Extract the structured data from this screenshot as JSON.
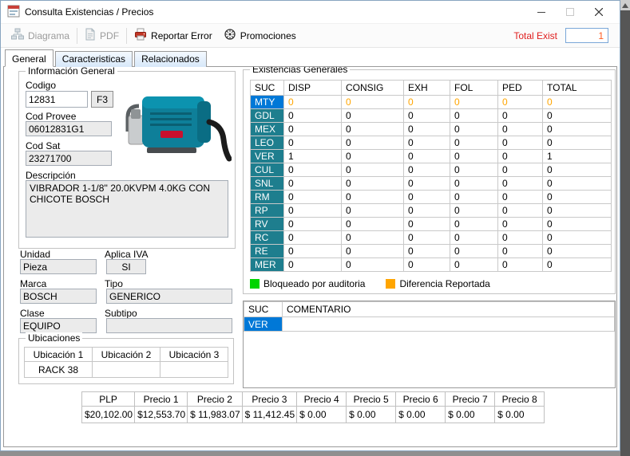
{
  "window": {
    "title": "Consulta Existencias / Precios"
  },
  "toolbar": {
    "items": [
      {
        "label": "Diagrama",
        "disabled": true
      },
      {
        "label": "PDF",
        "disabled": true
      },
      {
        "label": "Reportar Error",
        "disabled": false
      },
      {
        "label": "Promociones",
        "disabled": false
      }
    ],
    "total_exist_label": "Total Exist",
    "total_exist_value": "1"
  },
  "tabs": {
    "general": "General",
    "caracteristicas": "Caracteristicas",
    "relacionados": "Relacionados"
  },
  "info": {
    "group_title": "Información General",
    "codigo_label": "Codigo",
    "codigo_value": "12831",
    "f3_label": "F3",
    "cod_provee_label": "Cod Provee",
    "cod_provee_value": "06012831G1",
    "cod_sat_label": "Cod Sat",
    "cod_sat_value": "23271700",
    "descripcion_label": "Descripción",
    "descripcion_value": "VIBRADOR 1-1/8'' 20.0KVPM 4.0KG CON CHICOTE BOSCH"
  },
  "detalles": {
    "unidad_label": "Unidad",
    "unidad_value": "Pieza",
    "aplica_iva_label": "Aplica IVA",
    "aplica_iva_value": "SI",
    "marca_label": "Marca",
    "marca_value": "BOSCH",
    "tipo_label": "Tipo",
    "tipo_value": "GENERICO",
    "clase_label": "Clase",
    "clase_value": "EQUIPO",
    "subtipo_label": "Subtipo",
    "subtipo_value": ""
  },
  "ubicaciones": {
    "group_title": "Ubicaciones",
    "headers": [
      "Ubicación 1",
      "Ubicación 2",
      "Ubicación 3"
    ],
    "values": [
      "RACK 38",
      "",
      ""
    ]
  },
  "existencias": {
    "group_title": "Existencias Generales",
    "headers": [
      "SUC",
      "DISP",
      "CONSIG",
      "EXH",
      "FOL",
      "PED",
      "TOTAL"
    ],
    "rows": [
      {
        "suc": "MTY",
        "values": [
          "0",
          "0",
          "0",
          "0",
          "0",
          "0"
        ],
        "selected": true,
        "orange_values": true
      },
      {
        "suc": "GDL",
        "values": [
          "0",
          "0",
          "0",
          "0",
          "0",
          "0"
        ]
      },
      {
        "suc": "MEX",
        "values": [
          "0",
          "0",
          "0",
          "0",
          "0",
          "0"
        ]
      },
      {
        "suc": "LEO",
        "values": [
          "0",
          "0",
          "0",
          "0",
          "0",
          "0"
        ]
      },
      {
        "suc": "VER",
        "values": [
          "1",
          "0",
          "0",
          "0",
          "0",
          "1"
        ]
      },
      {
        "suc": "CUL",
        "values": [
          "0",
          "0",
          "0",
          "0",
          "0",
          "0"
        ]
      },
      {
        "suc": "SNL",
        "values": [
          "0",
          "0",
          "0",
          "0",
          "0",
          "0"
        ]
      },
      {
        "suc": "RM",
        "values": [
          "0",
          "0",
          "0",
          "0",
          "0",
          "0"
        ]
      },
      {
        "suc": "RP",
        "values": [
          "0",
          "0",
          "0",
          "0",
          "0",
          "0"
        ]
      },
      {
        "suc": "RV",
        "values": [
          "0",
          "0",
          "0",
          "0",
          "0",
          "0"
        ]
      },
      {
        "suc": "RC",
        "values": [
          "0",
          "0",
          "0",
          "0",
          "0",
          "0"
        ]
      },
      {
        "suc": "RE",
        "values": [
          "0",
          "0",
          "0",
          "0",
          "0",
          "0"
        ]
      },
      {
        "suc": "MER",
        "values": [
          "0",
          "0",
          "0",
          "0",
          "0",
          "0"
        ]
      }
    ],
    "legend": [
      {
        "color": "#00d400",
        "label": "Bloqueado por auditoria"
      },
      {
        "color": "#ffa500",
        "label": "Diferencia Reportada"
      }
    ]
  },
  "comentarios": {
    "headers": [
      "SUC",
      "COMENTARIO"
    ],
    "rows": [
      {
        "suc": "VER",
        "comentario": "",
        "selected": true
      }
    ]
  },
  "precios": {
    "headers": [
      "PLP",
      "Precio 1",
      "Precio 2",
      "Precio 3",
      "Precio 4",
      "Precio 5",
      "Precio 6",
      "Precio 7",
      "Precio 8"
    ],
    "values": [
      "$20,102.00",
      "$12,553.70",
      "$ 11,983.07",
      "$ 11,412.45",
      "$ 0.00",
      "$ 0.00",
      "$ 0.00",
      "$ 0.00",
      "$ 0.00"
    ]
  },
  "colors": {
    "suc-bg": "#1e7e8e",
    "selection": "#0078d7",
    "warn-orange": "#ffa500",
    "red": "#e02020",
    "value-orange": "#ff5a1f"
  }
}
